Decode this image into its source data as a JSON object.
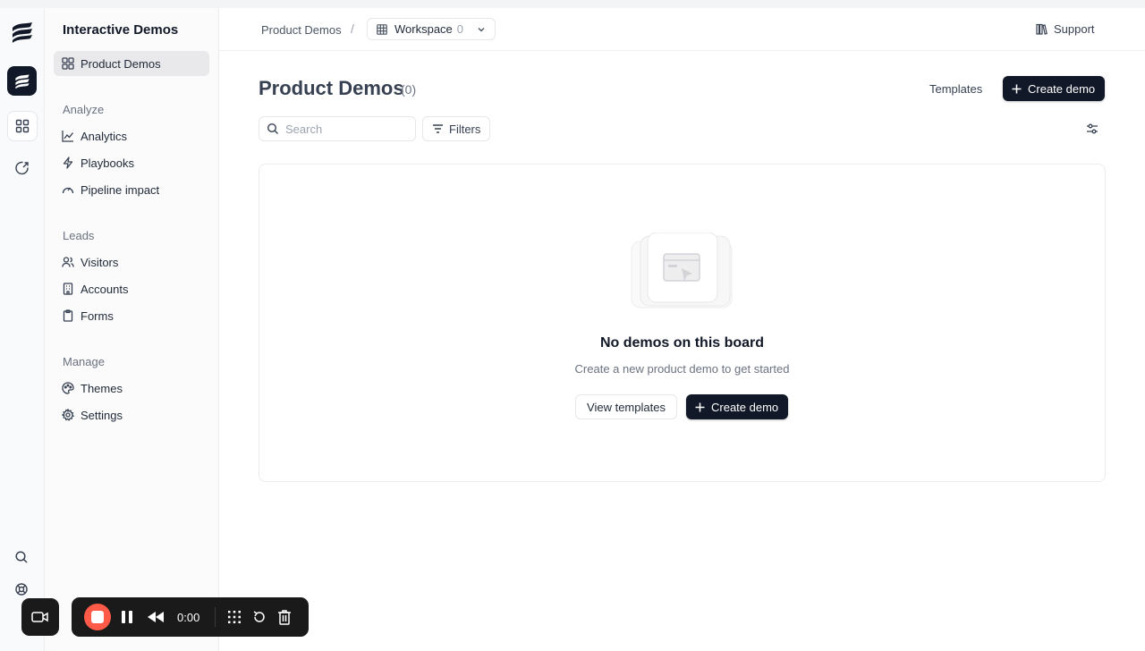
{
  "app": {
    "title": "Interactive Demos"
  },
  "sidebar": {
    "items_top": [
      {
        "label": "Product Demos",
        "icon": "grid-icon",
        "active": true
      }
    ],
    "sections": [
      {
        "heading": "Analyze",
        "items": [
          {
            "label": "Analytics",
            "icon": "line-chart-icon"
          },
          {
            "label": "Playbooks",
            "icon": "bolt-icon"
          },
          {
            "label": "Pipeline impact",
            "icon": "gauge-icon"
          }
        ]
      },
      {
        "heading": "Leads",
        "items": [
          {
            "label": "Visitors",
            "icon": "users-icon"
          },
          {
            "label": "Accounts",
            "icon": "building-icon"
          },
          {
            "label": "Forms",
            "icon": "clipboard-icon"
          }
        ]
      },
      {
        "heading": "Manage",
        "items": [
          {
            "label": "Themes",
            "icon": "palette-icon"
          },
          {
            "label": "Settings",
            "icon": "gear-icon"
          }
        ]
      }
    ]
  },
  "header": {
    "breadcrumb": "Product Demos",
    "separator": "/",
    "workspace_label": "Workspace",
    "workspace_count": "0",
    "support_label": "Support"
  },
  "main": {
    "title": "Product Demos",
    "count": "(0)",
    "templates_label": "Templates",
    "create_demo_label": "Create demo",
    "search_placeholder": "Search",
    "filters_label": "Filters"
  },
  "empty_state": {
    "title": "No demos on this board",
    "subtitle": "Create a new product demo to get started",
    "view_templates_label": "View templates",
    "create_demo_label": "Create demo"
  },
  "recorder": {
    "time": "0:00"
  },
  "colors": {
    "accent_dark": "#111827",
    "record": "#ff5a47",
    "active_item_bg": "#e9e9eb"
  }
}
